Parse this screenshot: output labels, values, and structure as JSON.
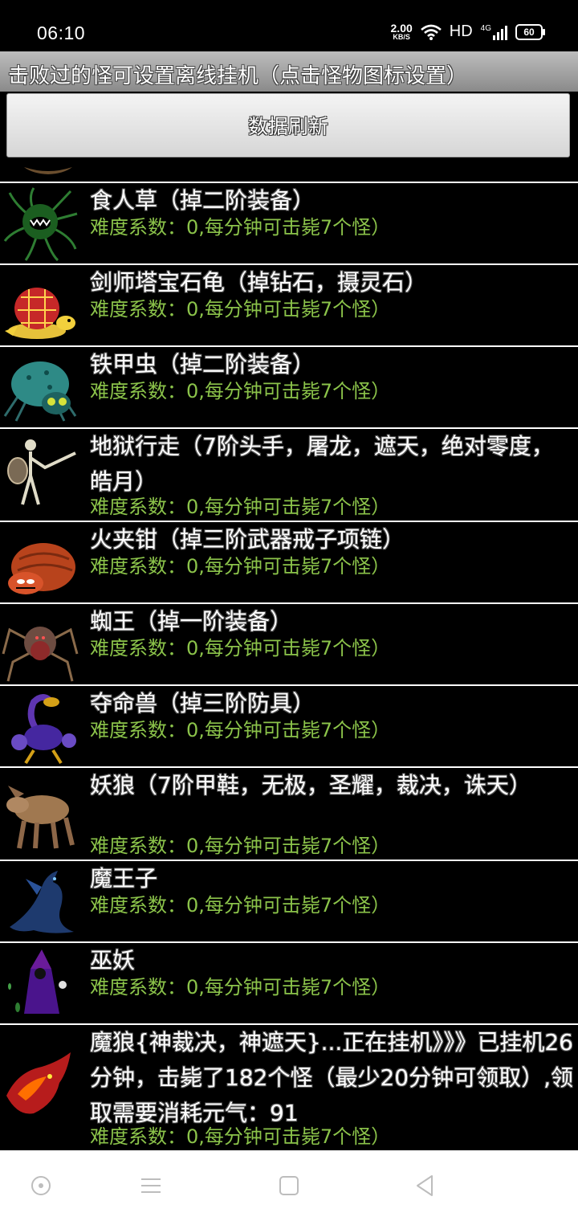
{
  "status": {
    "time": "06:10",
    "net_speed": "2.00",
    "net_unit": "KB/S",
    "hd": "HD",
    "signal": "4G",
    "battery": "60"
  },
  "header": {
    "title": "击败过的怪可设置离线挂机（点击怪物图标设置）"
  },
  "toolbar": {
    "refresh_label": "数据刷新"
  },
  "monsters": [
    {
      "name": "食人草（掉二阶装备）",
      "stat": "难度系数：0,每分钟可击毙7个怪）",
      "icon": "man-eating-plant-icon"
    },
    {
      "name": "剑师塔宝石龟（掉钻石，摄灵石）",
      "stat": "难度系数：0,每分钟可击毙7个怪）",
      "icon": "gem-turtle-icon"
    },
    {
      "name": "铁甲虫（掉二阶装备）",
      "stat": "难度系数：0,每分钟可击毙7个怪）",
      "icon": "armored-beetle-icon"
    },
    {
      "name": "地狱行走（7阶头手，屠龙，遮天，绝对零度，皓月）",
      "stat": "难度系数：0,每分钟可击毙7个怪）",
      "icon": "skeleton-warrior-icon"
    },
    {
      "name": "火夹钳（掉三阶武器戒子项链）",
      "stat": "难度系数：0,每分钟可击毙7个怪）",
      "icon": "fire-crab-icon"
    },
    {
      "name": "蜘王（掉一阶装备）",
      "stat": "难度系数：0,每分钟可击毙7个怪）",
      "icon": "spider-king-icon"
    },
    {
      "name": "夺命兽（掉三阶防具）",
      "stat": "难度系数：0,每分钟可击毙7个怪）",
      "icon": "scorpion-beast-icon"
    },
    {
      "name": "妖狼（7阶甲鞋，无极，圣耀，裁决，诛天）",
      "stat": "难度系数：0,每分钟可击毙7个怪）",
      "icon": "demon-wolf-icon"
    },
    {
      "name": "魔王子",
      "stat": "难度系数：0,每分钟可击毙7个怪）",
      "icon": "demon-prince-icon"
    },
    {
      "name": "巫妖",
      "stat": "难度系数：0,每分钟可击毙7个怪）",
      "icon": "lich-icon"
    },
    {
      "name": "魔狼{神裁决，神遮天}...正在挂机》》》已挂机26分钟，击毙了182个怪（最少20分钟可领取）,领取需要消耗元气：91",
      "stat": "难度系数：0,每分钟可击毙7个怪）",
      "icon": "fire-wolf-icon"
    }
  ]
}
